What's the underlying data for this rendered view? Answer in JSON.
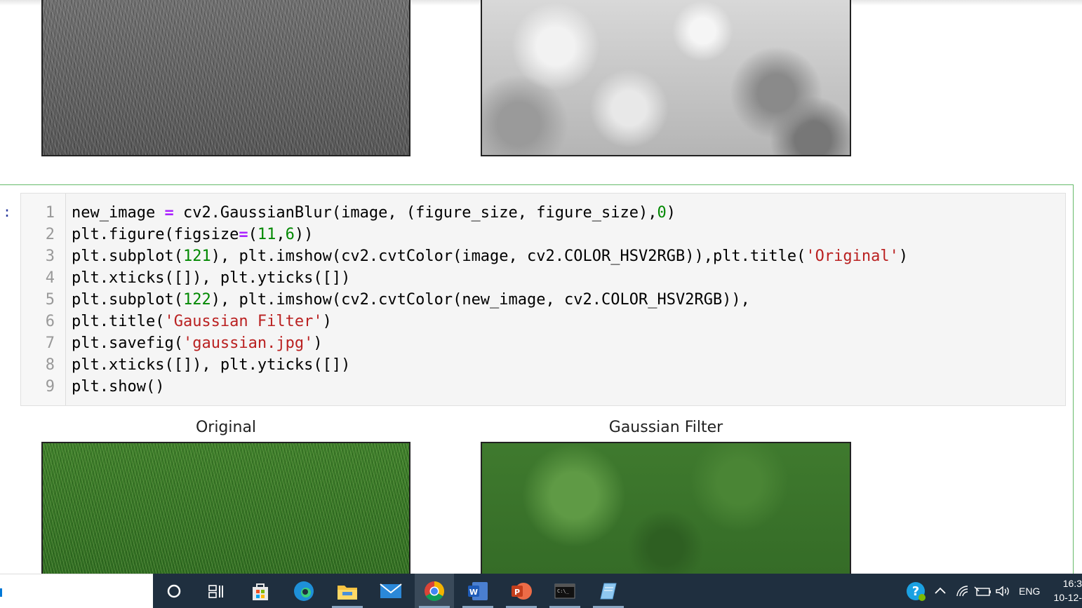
{
  "cell": {
    "prompt": ":",
    "line_numbers": [
      "1",
      "2",
      "3",
      "4",
      "5",
      "6",
      "7",
      "8",
      "9"
    ],
    "code": {
      "l1a": "new_image ",
      "l1op": "=",
      "l1b": " cv2.GaussianBlur(image, (figure_size, figure_size),",
      "l1n": "0",
      "l1c": ")",
      "l2a": "plt.figure(figsize",
      "l2op": "=",
      "l2b": "(",
      "l2n1": "11",
      "l2c": ",",
      "l2n2": "6",
      "l2d": "))",
      "l3a": "plt.subplot(",
      "l3n": "121",
      "l3b": "), plt.imshow(cv2.cvtColor(image, cv2.COLOR_HSV2RGB)),plt.title(",
      "l3s": "'Original'",
      "l3c": ")",
      "l4": "plt.xticks([]), plt.yticks([])",
      "l5a": "plt.subplot(",
      "l5n": "122",
      "l5b": "), plt.imshow(cv2.cvtColor(new_image, cv2.COLOR_HSV2RGB)),",
      "l6a": "plt.title(",
      "l6s": "'Gaussian Filter'",
      "l6b": ")",
      "l7a": "plt.savefig(",
      "l7s": "'gaussian.jpg'",
      "l7b": ")",
      "l8": "plt.xticks([]), plt.yticks([])",
      "l9": "plt.show()"
    }
  },
  "output": {
    "titles": [
      "Original",
      "Gaussian Filter"
    ]
  },
  "taskbar": {
    "apps": [
      "cortana-icon",
      "task-view-icon",
      "microsoft-store-icon",
      "edge-icon",
      "file-explorer-icon",
      "mail-icon",
      "chrome-icon",
      "word-icon",
      "powerpoint-icon",
      "terminal-icon",
      "notepad-icon"
    ],
    "tray": {
      "language": "ENG",
      "time": "16:3",
      "date": "10-12-"
    }
  },
  "colors": {
    "cell_border": "#66bb6a",
    "keyword": "#aa22ff",
    "number": "#008800",
    "string": "#ba2121",
    "taskbar": "#1f2f3f"
  }
}
